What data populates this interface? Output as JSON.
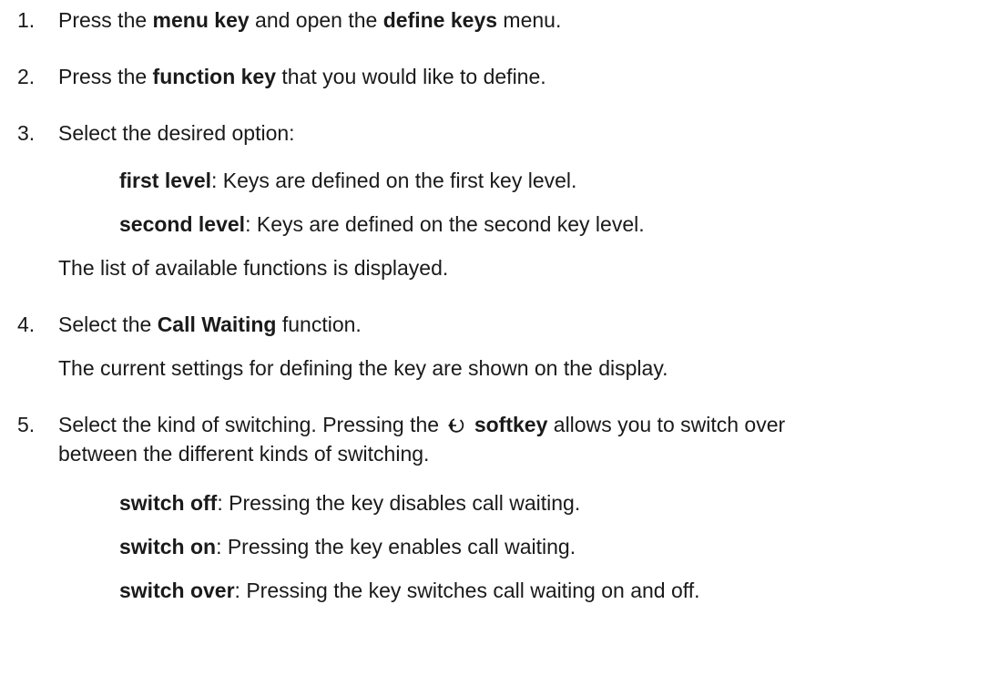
{
  "steps": [
    {
      "number": "1.",
      "pre": "Press the ",
      "b1": "menu key",
      "mid": " and open the ",
      "b2": "define keys",
      "post": " menu."
    },
    {
      "number": "2.",
      "pre": "Press the ",
      "b1": "function key",
      "post": " that you would like to define."
    },
    {
      "number": "3.",
      "text": "Select the desired option:",
      "options": [
        {
          "term": "first level",
          "desc": ": Keys are defined on the first key level."
        },
        {
          "term": "second level",
          "desc": ": Keys are defined on the second key level."
        }
      ],
      "note": "The list of available functions is displayed."
    },
    {
      "number": "4.",
      "pre": "Select the ",
      "b1": "Call Waiting",
      "post": " function.",
      "note": "The current settings for defining the key are shown on the display."
    },
    {
      "number": "5.",
      "pre": "Select the kind of switching. Pressing the ",
      "icon": "toggle-arrow-icon",
      "b1": "softkey",
      "post": " allows you to switch over",
      "line2": "between the different kinds of switching.",
      "options": [
        {
          "term": "switch off",
          "desc": ": Pressing the key disables call waiting."
        },
        {
          "term": "switch on",
          "desc": ": Pressing the key enables call waiting."
        },
        {
          "term": "switch over",
          "desc": ": Pressing the key switches call waiting on and off."
        }
      ]
    }
  ]
}
